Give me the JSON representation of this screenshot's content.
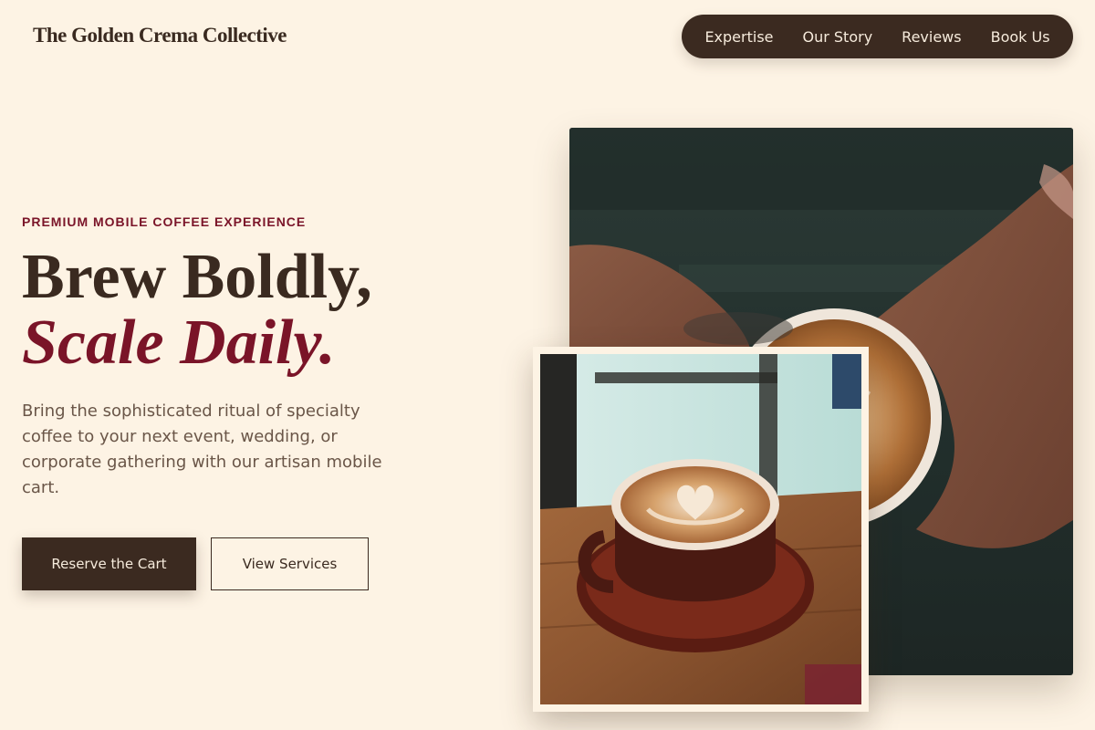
{
  "brand": {
    "name": "The Golden Crema Collective"
  },
  "nav": {
    "items": [
      {
        "label": "Expertise"
      },
      {
        "label": "Our Story"
      },
      {
        "label": "Reviews"
      },
      {
        "label": "Book Us"
      }
    ]
  },
  "hero": {
    "eyebrow": "PREMIUM MOBILE COFFEE EXPERIENCE",
    "headline_line1": "Brew Boldly,",
    "headline_line2": "Scale Daily.",
    "description": "Bring the sophisticated ritual of specialty coffee to your next event, wedding, or corporate gathering with our artisan mobile cart.",
    "primary_cta": "Reserve the Cart",
    "secondary_cta": "View Services"
  },
  "colors": {
    "background": "#fdf3e4",
    "espresso": "#3b2a20",
    "accent": "#7a1428",
    "body_text": "#6a5648"
  },
  "images": {
    "main": "barista-hands-latte-photo",
    "inset": "latte-art-cup-on-table-photo"
  }
}
